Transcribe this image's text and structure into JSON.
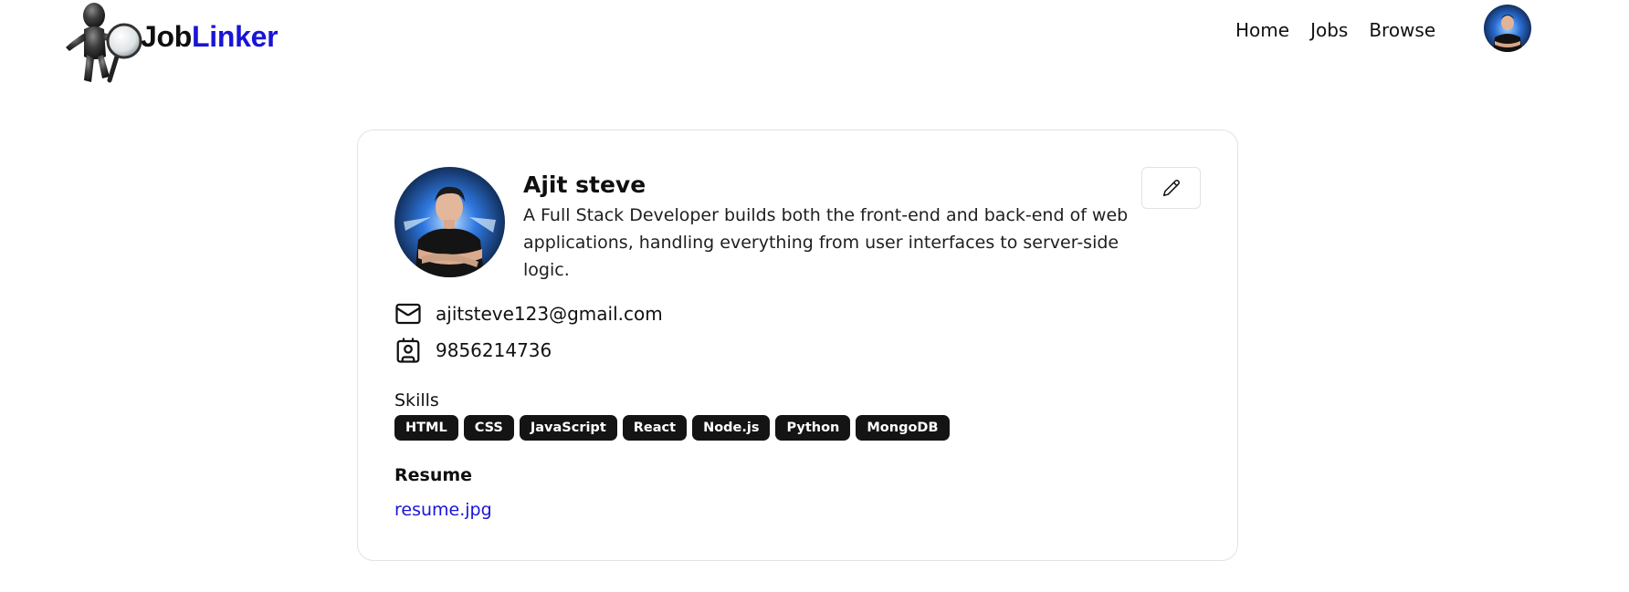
{
  "brand": {
    "part1": "Job",
    "part2": "Linker",
    "accent_color": "#1a14d6"
  },
  "nav": {
    "links": [
      {
        "label": "Home"
      },
      {
        "label": "Jobs"
      },
      {
        "label": "Browse"
      }
    ],
    "avatar_icon": "user-avatar"
  },
  "profile": {
    "name": "Ajit steve",
    "bio": "A Full Stack Developer builds both the front-end and back-end of web applications, handling everything from user interfaces to server-side logic.",
    "email": "ajitsteve123@gmail.com",
    "phone": "9856214736",
    "edit_icon": "pen-icon",
    "email_icon": "mail-icon",
    "phone_icon": "contact-card-icon",
    "skills_label": "Skills",
    "skills": [
      "HTML",
      "CSS",
      "JavaScript",
      "React",
      "Node.js",
      "Python",
      "MongoDB"
    ],
    "resume_heading": "Resume",
    "resume_file": "resume.jpg"
  }
}
